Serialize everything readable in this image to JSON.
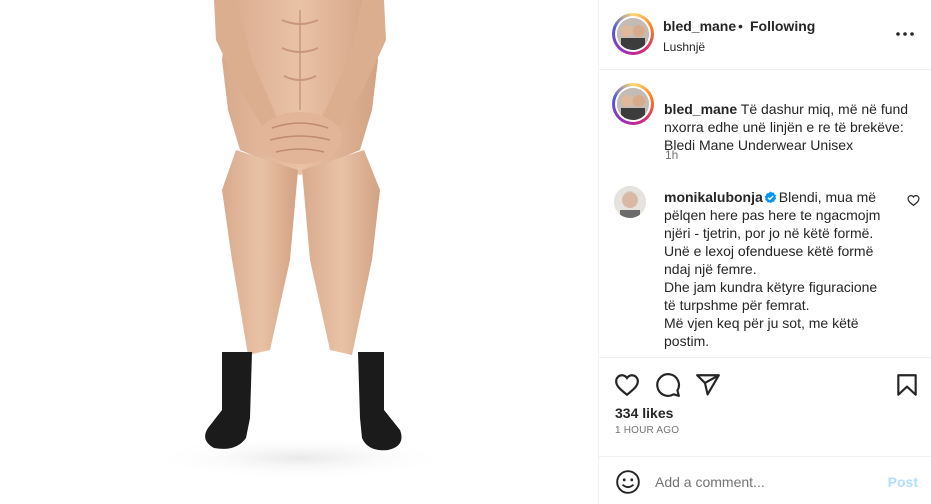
{
  "post": {
    "username": "bled_mane",
    "separator": "•",
    "follow_status": "Following",
    "location": "Lushnjë",
    "caption_text": "Të dashur miq, më në fund nxorra edhe unë linjën e re të brekëve: Bledi Mane Underwear Unisex",
    "caption_time": "1h"
  },
  "comment": {
    "username": "monikalubonja",
    "lines": [
      "Blendi, mua më",
      "pëlqen here pas here te ngacmojm",
      "njëri - tjetrin, por jo në këtë formë.",
      "Unë e lexoj ofenduese këtë formë",
      "ndaj një femre.",
      "Dhe jam kundra këtyre figuracione",
      "të turpshme për femrat.",
      "Më vjen keq për ju sot, me këtë",
      "postim."
    ]
  },
  "stats": {
    "likes": "334 likes",
    "time_ago": "1 HOUR AGO"
  },
  "composer": {
    "placeholder": "Add a comment...",
    "post_label": "Post"
  },
  "icons": {
    "more": "more-options-icon",
    "like": "heart-icon",
    "comment": "comment-icon",
    "share": "share-icon",
    "save": "bookmark-icon",
    "emoji": "emoji-icon",
    "verified": "verified-badge-icon",
    "comment_like": "heart-small-icon"
  },
  "colors": {
    "text": "#262626",
    "muted": "#737373",
    "verified": "#0095f6",
    "post_disabled": "#b2dffc",
    "divider": "#efefef"
  }
}
